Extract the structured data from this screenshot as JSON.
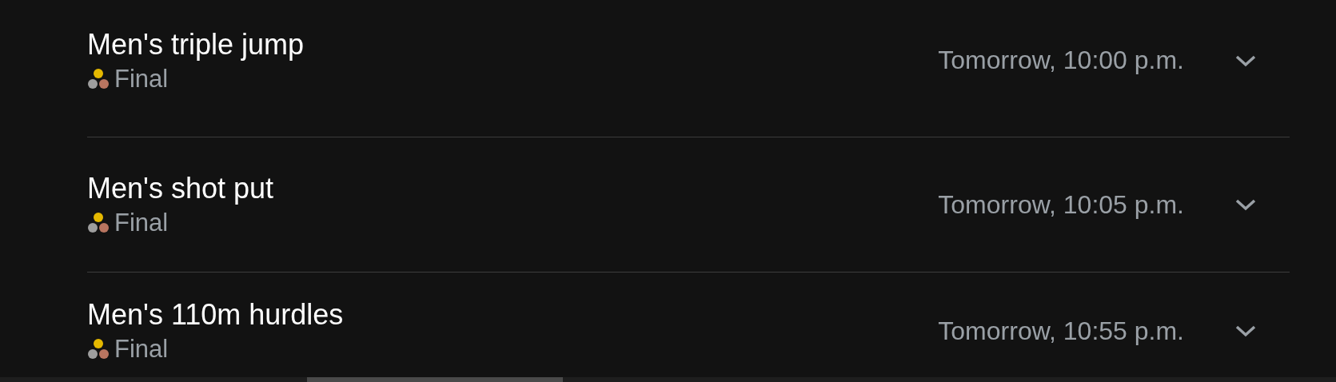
{
  "events": [
    {
      "title": "Men's triple jump",
      "stage": "Final",
      "time": "Tomorrow, 10:00 p.m.",
      "expanded": false
    },
    {
      "title": "Men's shot put",
      "stage": "Final",
      "time": "Tomorrow, 10:05 p.m.",
      "expanded": false
    },
    {
      "title": "Men's 110m hurdles",
      "stage": "Final",
      "time": "Tomorrow, 10:55 p.m.",
      "expanded": false
    }
  ]
}
